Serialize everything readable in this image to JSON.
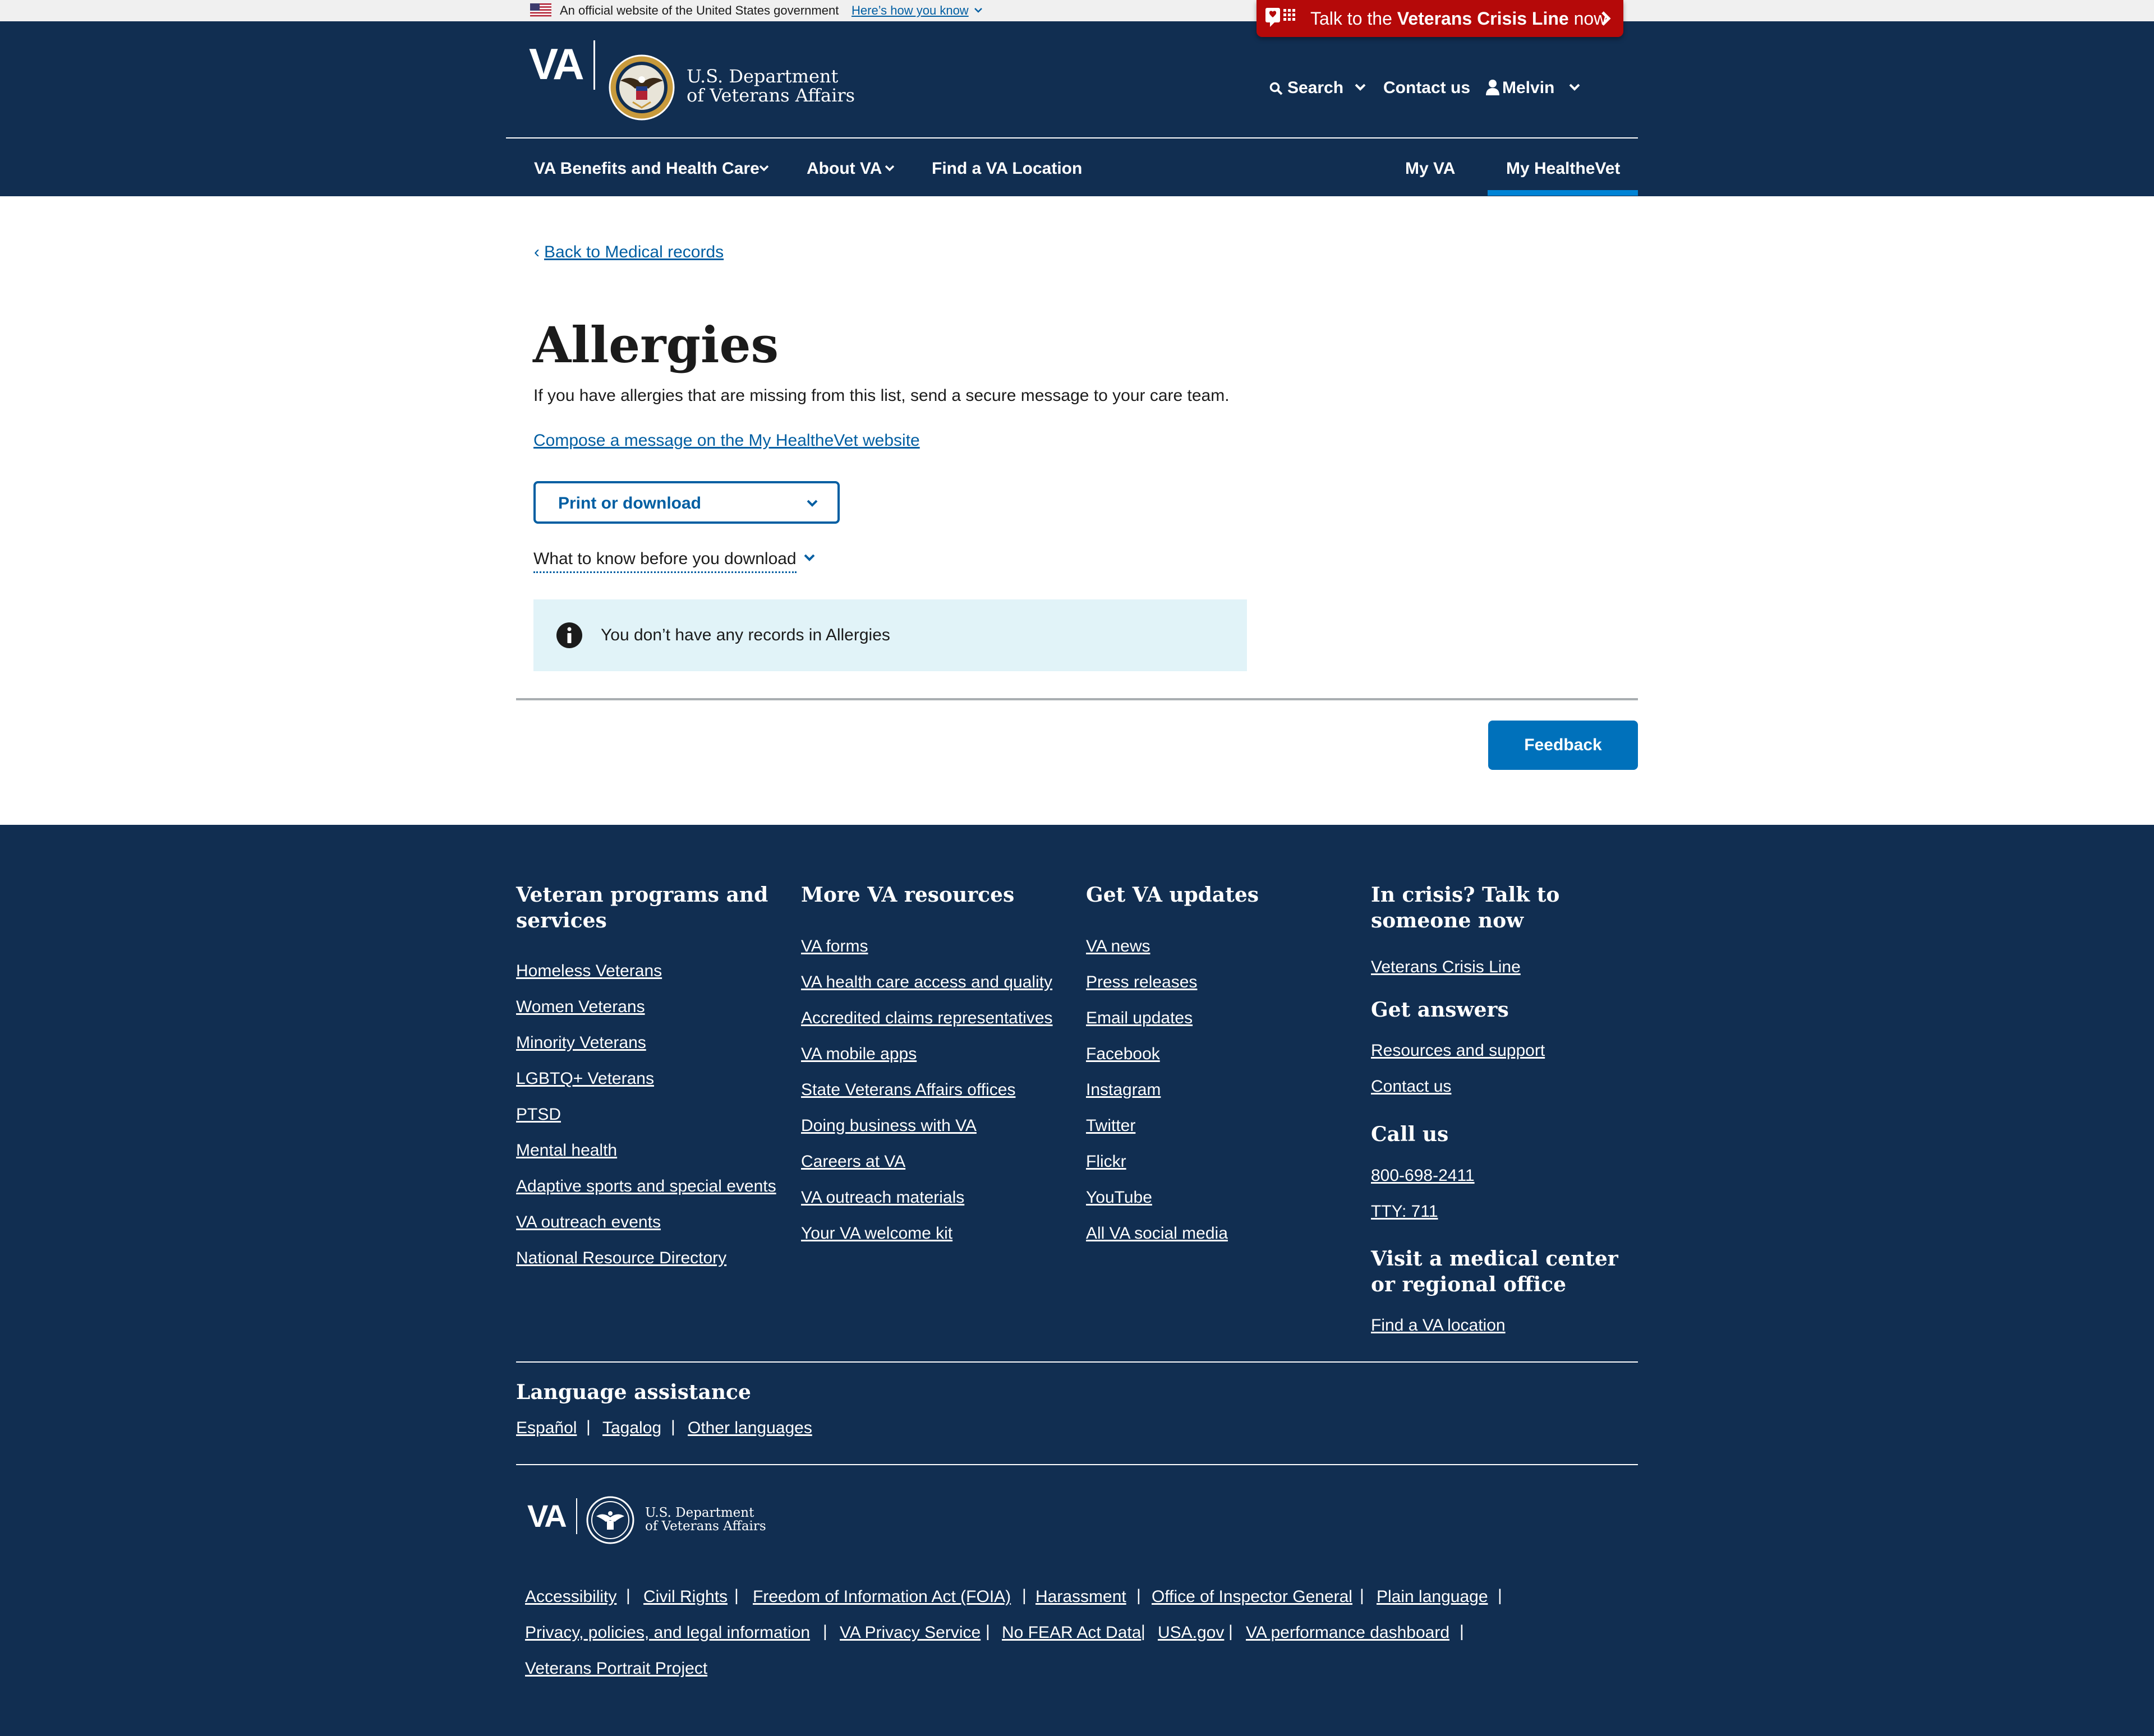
{
  "gov_banner": {
    "text": "An official website of the United States government",
    "link": "Here’s how you know"
  },
  "crisis_line": {
    "prefix": "Talk to the ",
    "bold": "Veterans Crisis Line",
    "suffix": " now"
  },
  "header": {
    "logo": "VA",
    "dept_line1": "U.S. Department",
    "dept_line2": "of Veterans Affairs",
    "search": "Search",
    "contact": "Contact us",
    "user": "Melvin",
    "nav": {
      "benefits": "VA Benefits and Health Care",
      "about": "About VA",
      "find": "Find a VA Location",
      "my_va": "My VA",
      "my_healthevet": "My HealtheVet"
    }
  },
  "main": {
    "back_link": "Back to Medical records",
    "title": "Allergies",
    "intro": "If you have allergies that are missing from this list, send a secure message to your care team.",
    "compose_link": "Compose a message on the My HealtheVet website",
    "print_button": "Print or download",
    "know_before": "What to know before you download",
    "alert_text": "You don’t have any records in Allergies",
    "feedback": "Feedback"
  },
  "footer": {
    "col1": {
      "heading": "Veteran programs and services",
      "links": [
        "Homeless Veterans",
        "Women Veterans",
        "Minority Veterans",
        "LGBTQ+ Veterans",
        "PTSD",
        "Mental health",
        "Adaptive sports and special events",
        "VA outreach events",
        "National Resource Directory"
      ]
    },
    "col2": {
      "heading": "More VA resources",
      "links": [
        "VA forms",
        "VA health care access and quality",
        "Accredited claims representatives",
        "VA mobile apps",
        "State Veterans Affairs offices",
        "Doing business with VA",
        "Careers at VA",
        "VA outreach materials",
        "Your VA welcome kit"
      ]
    },
    "col3": {
      "heading": "Get VA updates",
      "links": [
        "VA news",
        "Press releases",
        "Email updates",
        "Facebook",
        "Instagram",
        "Twitter",
        "Flickr",
        "YouTube",
        "All VA social media"
      ]
    },
    "col4": {
      "crisis_heading": "In crisis? Talk to someone now",
      "crisis_link": "Veterans Crisis Line",
      "answers_heading": "Get answers",
      "answers_links": [
        "Resources and support",
        "Contact us"
      ],
      "call_heading": "Call us",
      "call_links": [
        "800-698-2411",
        "TTY: 711"
      ],
      "visit_heading": "Visit a medical center or regional office",
      "visit_link": "Find a VA location"
    },
    "language": {
      "heading": "Language assistance",
      "links": [
        "Español",
        "Tagalog",
        "Other languages"
      ]
    },
    "logo": "VA",
    "dept_line1": "U.S. Department",
    "dept_line2": "of Veterans Affairs",
    "bottom_links": [
      "Accessibility",
      "Civil Rights",
      "Freedom of Information Act (FOIA)",
      "Harassment",
      "Office of Inspector General",
      "Plain language",
      "Privacy, policies, and legal information",
      "VA Privacy Service",
      "No FEAR Act Data",
      "USA.gov",
      "VA performance dashboard",
      "Veterans Portrait Project"
    ]
  },
  "colors": {
    "navy": "#112e51",
    "link_blue": "#005ea2",
    "crisis_red": "#b50909",
    "alert_bg": "#e1f3f8",
    "button_blue": "#0071bb",
    "active_underline": "#0083d5"
  },
  "icons": [
    "us-flag-icon",
    "chevron-down-icon",
    "crisis-line-icon",
    "chevron-right-icon",
    "va-seal-icon",
    "search-icon",
    "user-icon",
    "info-icon"
  ]
}
